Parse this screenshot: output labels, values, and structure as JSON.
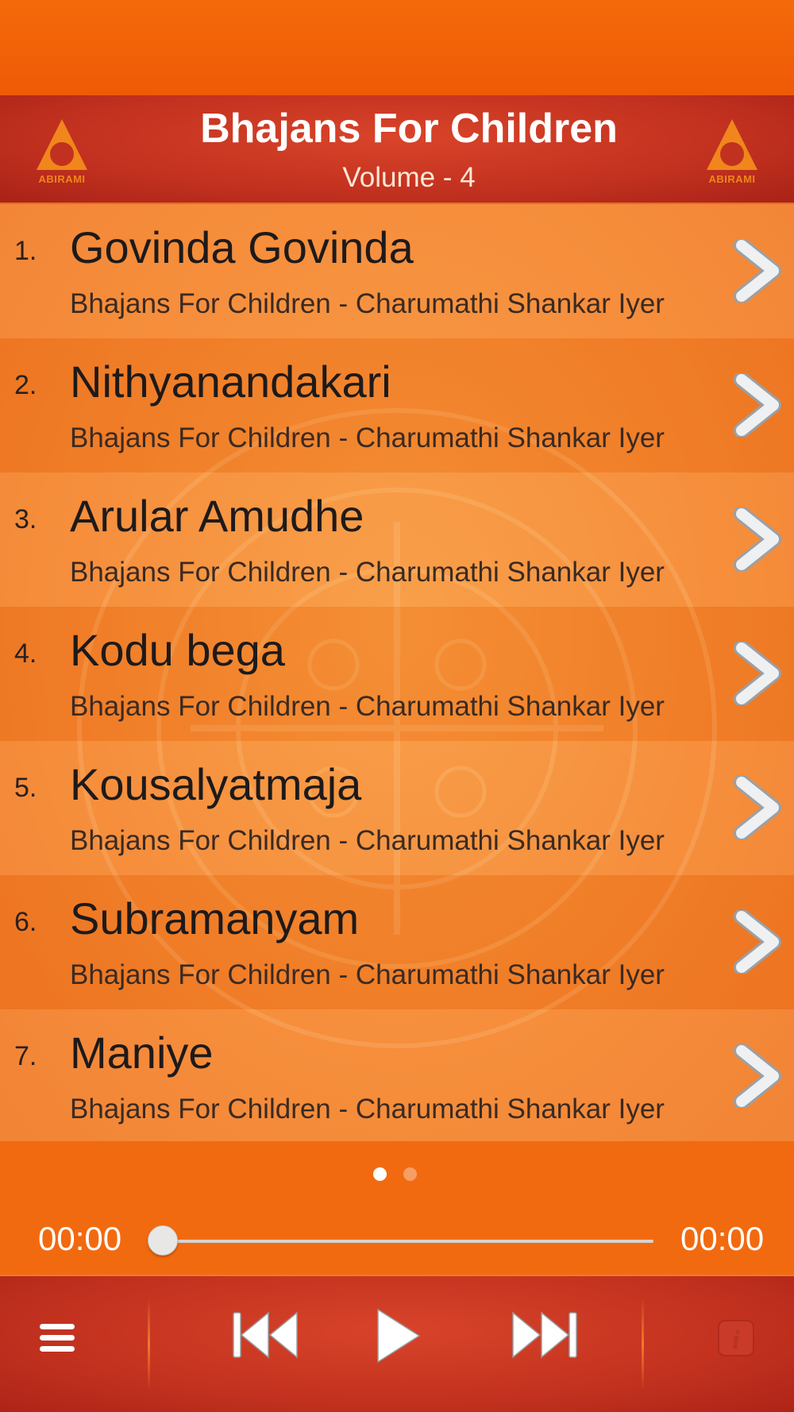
{
  "header": {
    "title": "Bhajans For Children",
    "subtitle": "Volume - 4",
    "logo_text": "ABIRAMI"
  },
  "tracks": [
    {
      "number": "1.",
      "title": "Govinda Govinda",
      "subtitle": "Bhajans For Children - Charumathi Shankar Iyer"
    },
    {
      "number": "2.",
      "title": "Nithyanandakari",
      "subtitle": "Bhajans For Children - Charumathi Shankar Iyer"
    },
    {
      "number": "3.",
      "title": "Arular Amudhe",
      "subtitle": "Bhajans For Children - Charumathi Shankar Iyer"
    },
    {
      "number": "4.",
      "title": "Kodu bega",
      "subtitle": "Bhajans For Children - Charumathi Shankar Iyer"
    },
    {
      "number": "5.",
      "title": "Kousalyatmaja",
      "subtitle": "Bhajans For Children - Charumathi Shankar Iyer"
    },
    {
      "number": "6.",
      "title": "Subramanyam",
      "subtitle": "Bhajans For Children - Charumathi Shankar Iyer"
    },
    {
      "number": "7.",
      "title": "Maniye",
      "subtitle": "Bhajans For Children - Charumathi Shankar Iyer"
    }
  ],
  "pager": {
    "pages": 2,
    "current": 1
  },
  "player": {
    "elapsed": "00:00",
    "total": "00:00",
    "progress": 0
  },
  "icons": {
    "menu": "menu-icon",
    "previous": "previous-track-icon",
    "play": "play-icon",
    "next": "next-track-icon",
    "info": "info-icon",
    "row_arrow": "chevron-right-icon",
    "logo": "abirami-logo"
  },
  "colors": {
    "header_red": "#c2311f",
    "list_orange": "#f4822a",
    "accent_orange": "#f26a10",
    "text_dark": "#1e1a1a",
    "white": "#ffffff"
  }
}
